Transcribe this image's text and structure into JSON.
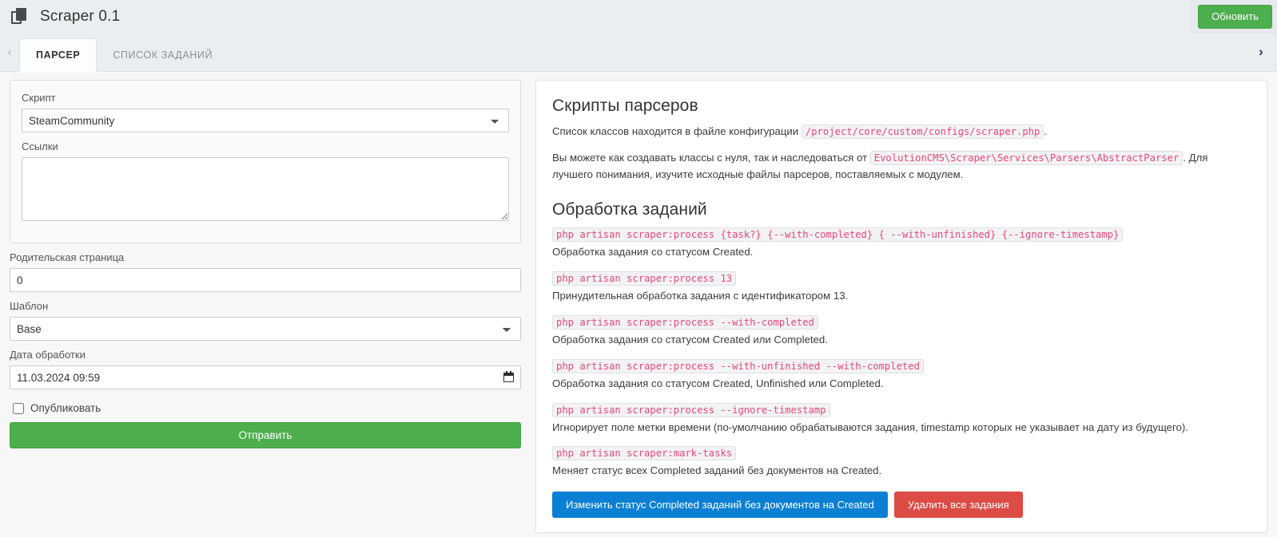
{
  "header": {
    "app_icon": "documents-icon",
    "title": "Scraper 0.1",
    "refresh_label": "Обновить"
  },
  "tabs": {
    "left_arrow": "‹",
    "right_arrow": "›",
    "items": [
      {
        "label": "ПАРСЕР",
        "active": true
      },
      {
        "label": "СПИСОК ЗАДАНИЙ",
        "active": false
      }
    ]
  },
  "form": {
    "script": {
      "label": "Скрипт",
      "value": "SteamCommunity",
      "options": [
        "SteamCommunity"
      ]
    },
    "links": {
      "label": "Ссылки",
      "value": "",
      "placeholder": ""
    },
    "parent_page": {
      "label": "Родительская страница",
      "value": "0"
    },
    "template": {
      "label": "Шаблон",
      "value": "Base",
      "options": [
        "Base"
      ]
    },
    "process_date": {
      "label": "Дата обработки",
      "value": "11.03.2024 09:59",
      "icon": "calendar-icon"
    },
    "publish": {
      "label": "Опубликовать",
      "checked": false
    },
    "submit_label": "Отправить"
  },
  "docs": {
    "section1_title": "Скрипты парсеров",
    "p1_before": "Список классов находится в файле конфигурации",
    "p1_code": "/project/core/custom/configs/scraper.php",
    "p1_after": ".",
    "p2_before": "Вы можете как создавать классы с нуля, так и наследоваться от",
    "p2_code": "EvolutionCMS\\Scraper\\Services\\Parsers\\AbstractParser",
    "p2_after": ". Для лучшего понимания, изучите исходные файлы парсеров, поставляемых с модулем.",
    "section2_title": "Обработка заданий",
    "commands": [
      {
        "cmd": "php artisan scraper:process {task?} {--with-completed} { --with-unfinished} {--ignore-timestamp}",
        "desc": "Обработка задания со статусом Created."
      },
      {
        "cmd": "php artisan scraper:process 13",
        "desc": "Принудительная обработка задания с идентификатором 13."
      },
      {
        "cmd": "php artisan scraper:process --with-completed",
        "desc": "Обработка задания со статусом Created или Completed."
      },
      {
        "cmd": "php artisan scraper:process --with-unfinished --with-completed",
        "desc": "Обработка задания со статусом Created, Unfinished или Completed."
      },
      {
        "cmd": "php artisan scraper:process --ignore-timestamp",
        "desc": "Игнорирует поле метки времени (по-умолчанию обрабатываются задания, timestamp которых не указывает на дату из будущего)."
      },
      {
        "cmd": "php artisan scraper:mark-tasks",
        "desc": "Меняет статус всех Completed заданий без документов на Created."
      }
    ],
    "btn_mark_label": "Изменить статус Completed заданий без документов на Created",
    "btn_delete_label": "Удалить все задания"
  },
  "colors": {
    "green": "#4cae4c",
    "blue": "#0a7fd4",
    "red": "#dc4b44",
    "code_pink": "#e8457f",
    "header_bg": "#ebeef0"
  }
}
